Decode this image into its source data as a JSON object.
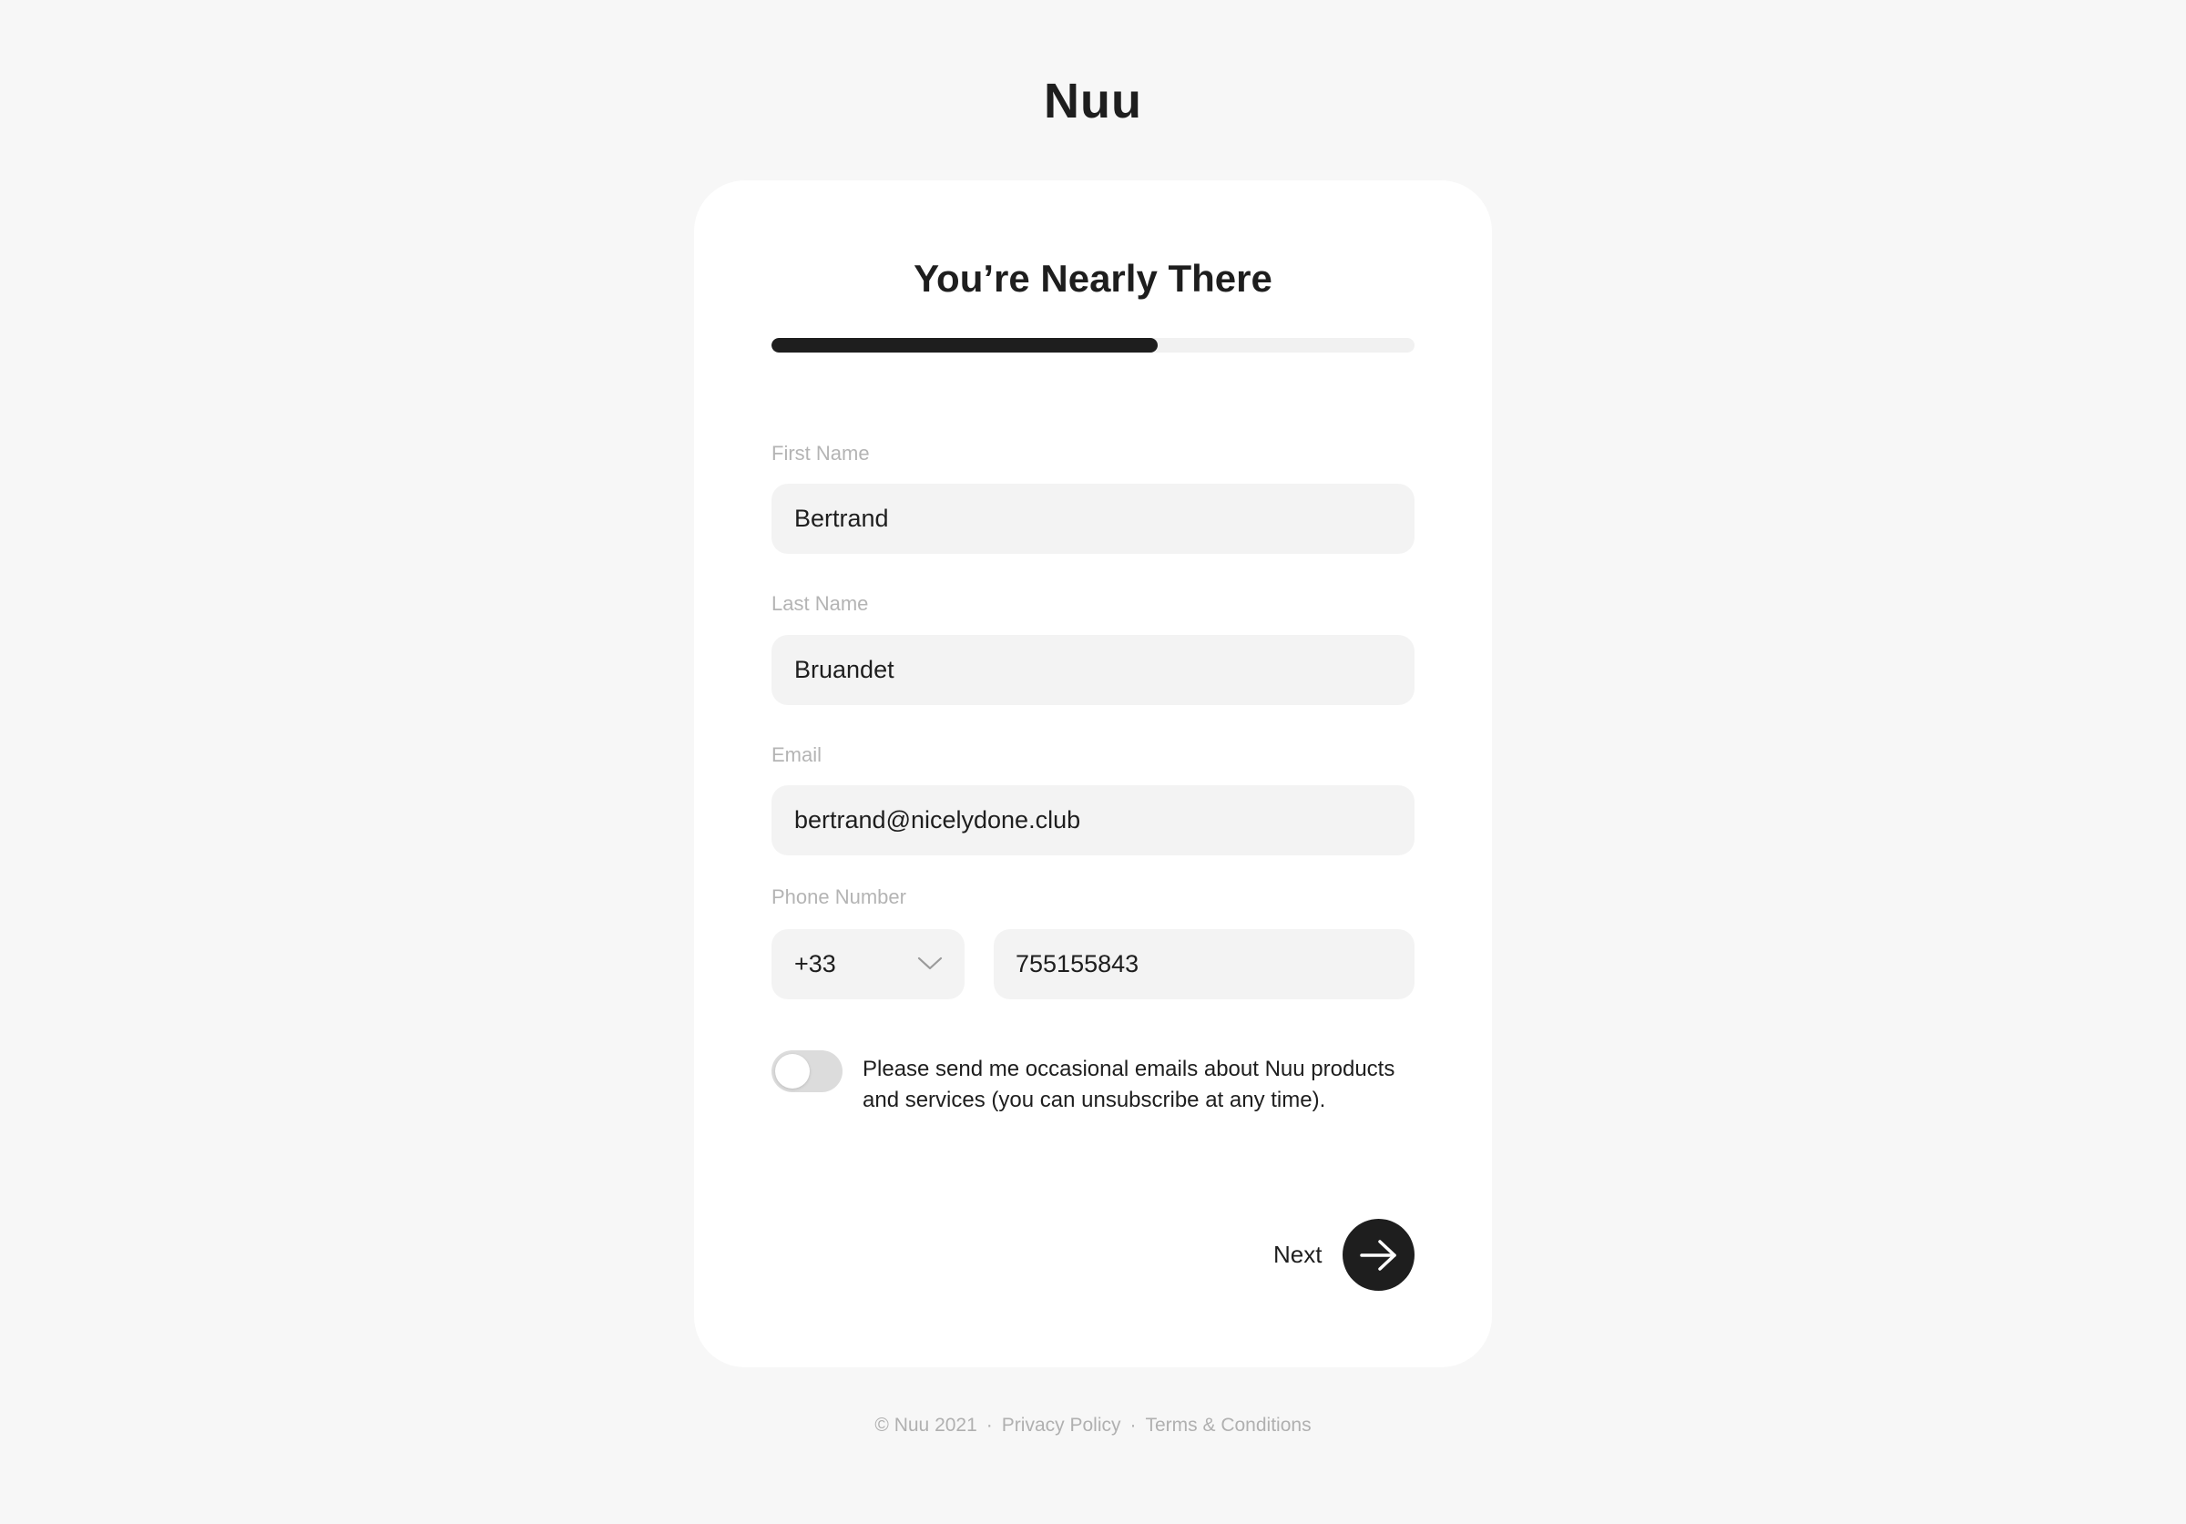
{
  "brand": {
    "logo_text": "Nuu"
  },
  "card": {
    "title": "You’re Nearly There",
    "progress_fraction": 0.6
  },
  "form": {
    "first_name": {
      "label": "First Name",
      "value": "Bertrand"
    },
    "last_name": {
      "label": "Last Name",
      "value": "Bruandet"
    },
    "email": {
      "label": "Email",
      "value": "bertrand@nicelydone.club"
    },
    "phone": {
      "label": "Phone Number",
      "country_code": "+33",
      "number": "755155843"
    },
    "consent": {
      "enabled": false,
      "text": "Please send me occasional emails about Nuu products and services (you can unsubscribe at any time)."
    },
    "next_label": "Next"
  },
  "footer": {
    "copyright": "© Nuu 2021",
    "separator": "·",
    "privacy": "Privacy Policy",
    "terms": "Terms & Conditions"
  },
  "colors": {
    "background": "#f7f7f7",
    "card": "#ffffff",
    "primary": "#1e1e1e",
    "input_bg": "#f3f3f3",
    "muted_text": "#b4b4b4"
  },
  "icons": {
    "select_chevron": "chevron-down-icon",
    "next": "arrow-right-icon"
  }
}
